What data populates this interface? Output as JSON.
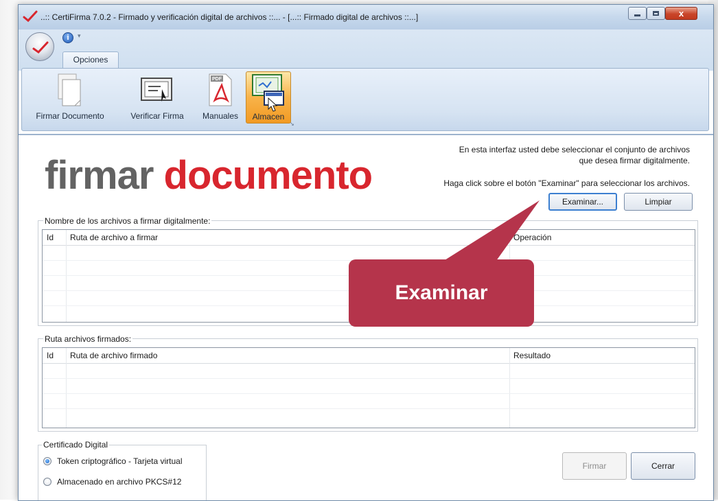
{
  "window": {
    "title": "..:: CertiFirma 7.0.2 - Firmado y verificación digital de archivos ::... - [...:: Firmado digital de archivos ::...]",
    "controls": {
      "minimize_icon": "minimize-icon",
      "maximize_icon": "maximize-icon",
      "close_label": "x"
    }
  },
  "ribbon": {
    "qat_info_label": "i",
    "qat_drop_label": "▾",
    "tabs": [
      {
        "label": "Opciones"
      }
    ],
    "buttons": [
      {
        "label": "Firmar Documento",
        "icon": "document-icon"
      },
      {
        "label": "Verificar Firma",
        "icon": "certificate-icon"
      },
      {
        "label": "Manuales",
        "icon": "pdf-icon"
      },
      {
        "label": "Almacen",
        "icon": "store-icon"
      }
    ],
    "pdf_badge": "PDF"
  },
  "header": {
    "title_part1": "firmar",
    "title_part2": "documento",
    "instruction_line1": "En esta interfaz usted debe seleccionar el conjunto de archivos",
    "instruction_line2": "que  desea firmar digitalmente.",
    "instruction_line3": "Haga click sobre el botón \"Examinar\" para seleccionar los archivos."
  },
  "actions": {
    "examinar_label": "Examinar...",
    "limpiar_label": "Limpiar",
    "firmar_label": "Firmar",
    "cerrar_label": "Cerrar"
  },
  "files_group": {
    "label": "Nombre de los archivos a firmar digitalmente:",
    "columns": [
      "Id",
      "Ruta de archivo a firmar",
      "Operación"
    ]
  },
  "signed_group": {
    "label": "Ruta archivos firmados:",
    "columns": [
      "Id",
      "Ruta de archivo firmado",
      "Resultado"
    ]
  },
  "certificate_group": {
    "label": "Certificado Digital",
    "options": [
      {
        "label": "Token criptográfico - Tarjeta virtual",
        "selected": true
      },
      {
        "label": "Almacenado en archivo PKCS#12",
        "selected": false
      }
    ]
  },
  "callout": {
    "text": "Examinar",
    "color": "#b5344b"
  },
  "colors": {
    "title_gray": "#636363",
    "title_red": "#d8262e",
    "ribbon_blue": "#d6e3f2",
    "active_orange": "#f8b34a"
  }
}
